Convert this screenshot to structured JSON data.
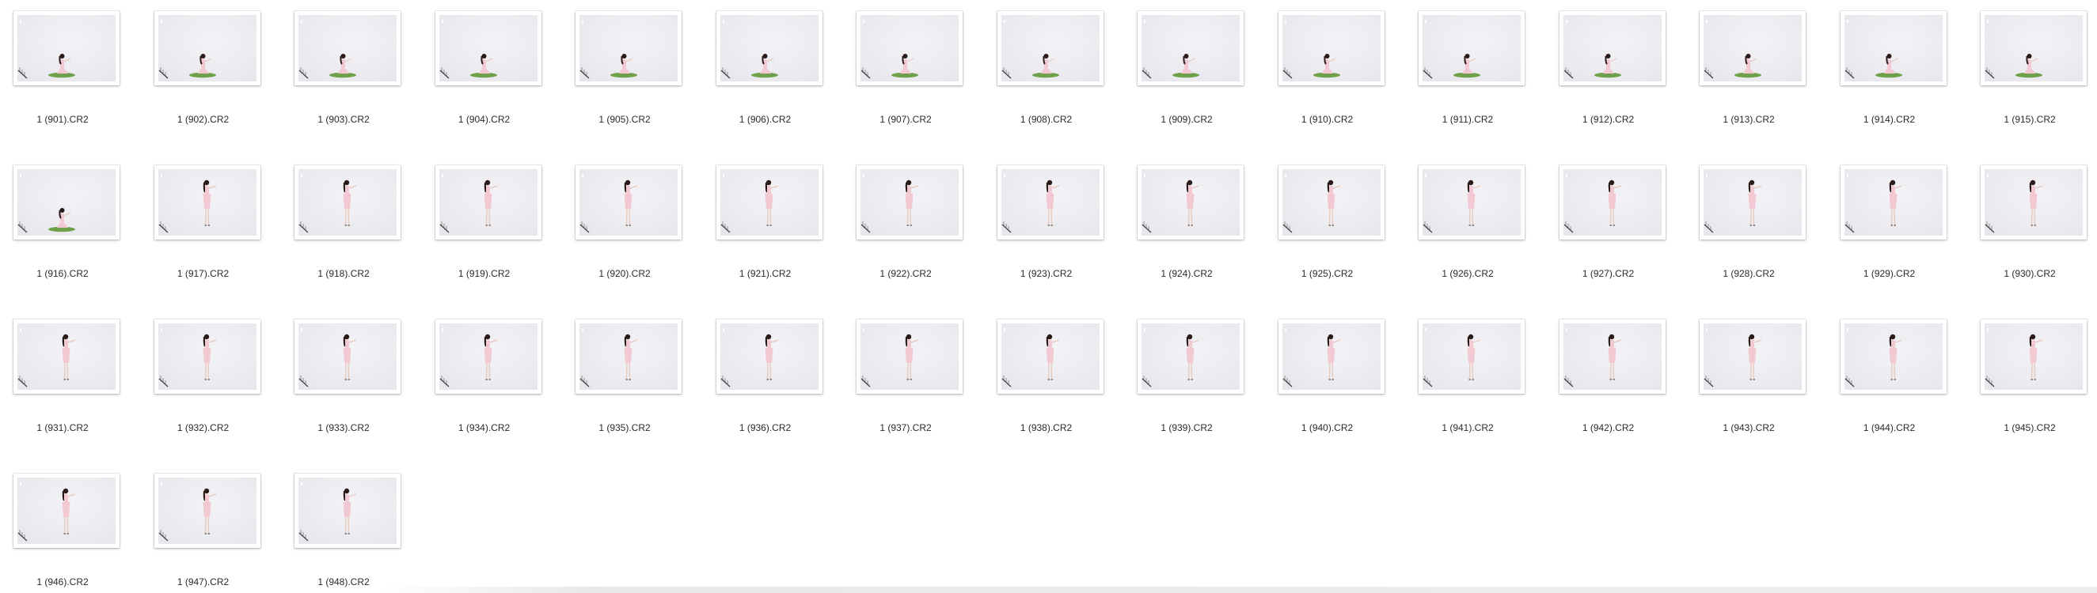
{
  "window": {
    "background": "#ffffff"
  },
  "files": [
    {
      "name": "1 (901).CR2",
      "pose": "sitting"
    },
    {
      "name": "1 (902).CR2",
      "pose": "sitting"
    },
    {
      "name": "1 (903).CR2",
      "pose": "sitting"
    },
    {
      "name": "1 (904).CR2",
      "pose": "sitting"
    },
    {
      "name": "1 (905).CR2",
      "pose": "sitting"
    },
    {
      "name": "1 (906).CR2",
      "pose": "sitting"
    },
    {
      "name": "1 (907).CR2",
      "pose": "sitting"
    },
    {
      "name": "1 (908).CR2",
      "pose": "sitting"
    },
    {
      "name": "1 (909).CR2",
      "pose": "sitting"
    },
    {
      "name": "1 (910).CR2",
      "pose": "sitting"
    },
    {
      "name": "1 (911).CR2",
      "pose": "sitting"
    },
    {
      "name": "1 (912).CR2",
      "pose": "sitting"
    },
    {
      "name": "1 (913).CR2",
      "pose": "sitting"
    },
    {
      "name": "1 (914).CR2",
      "pose": "sitting"
    },
    {
      "name": "1 (915).CR2",
      "pose": "sitting"
    },
    {
      "name": "1 (916).CR2",
      "pose": "sitting"
    },
    {
      "name": "1 (917).CR2",
      "pose": "standing"
    },
    {
      "name": "1 (918).CR2",
      "pose": "standing"
    },
    {
      "name": "1 (919).CR2",
      "pose": "standing"
    },
    {
      "name": "1 (920).CR2",
      "pose": "standing"
    },
    {
      "name": "1 (921).CR2",
      "pose": "standing"
    },
    {
      "name": "1 (922).CR2",
      "pose": "standing"
    },
    {
      "name": "1 (923).CR2",
      "pose": "standing"
    },
    {
      "name": "1 (924).CR2",
      "pose": "standing"
    },
    {
      "name": "1 (925).CR2",
      "pose": "standing"
    },
    {
      "name": "1 (926).CR2",
      "pose": "standing"
    },
    {
      "name": "1 (927).CR2",
      "pose": "standing"
    },
    {
      "name": "1 (928).CR2",
      "pose": "standing"
    },
    {
      "name": "1 (929).CR2",
      "pose": "standing"
    },
    {
      "name": "1 (930).CR2",
      "pose": "standing"
    },
    {
      "name": "1 (931).CR2",
      "pose": "standing"
    },
    {
      "name": "1 (932).CR2",
      "pose": "standing"
    },
    {
      "name": "1 (933).CR2",
      "pose": "standing"
    },
    {
      "name": "1 (934).CR2",
      "pose": "standing"
    },
    {
      "name": "1 (935).CR2",
      "pose": "standing"
    },
    {
      "name": "1 (936).CR2",
      "pose": "standing"
    },
    {
      "name": "1 (937).CR2",
      "pose": "standing"
    },
    {
      "name": "1 (938).CR2",
      "pose": "standing"
    },
    {
      "name": "1 (939).CR2",
      "pose": "standing"
    },
    {
      "name": "1 (940).CR2",
      "pose": "standing"
    },
    {
      "name": "1 (941).CR2",
      "pose": "standing"
    },
    {
      "name": "1 (942).CR2",
      "pose": "standing"
    },
    {
      "name": "1 (943).CR2",
      "pose": "standing"
    },
    {
      "name": "1 (944).CR2",
      "pose": "standing"
    },
    {
      "name": "1 (945).CR2",
      "pose": "standing"
    },
    {
      "name": "1 (946).CR2",
      "pose": "standing"
    },
    {
      "name": "1 (947).CR2",
      "pose": "standing"
    },
    {
      "name": "1 (948).CR2",
      "pose": "standing"
    }
  ],
  "colors": {
    "backdrop": "#e6e6ec",
    "backdrop_light": "#f3f3f7",
    "dress": "#f2c9d2",
    "hair": "#2a1a18",
    "mat": "#6fa14a",
    "label": "#2a2a2a"
  }
}
